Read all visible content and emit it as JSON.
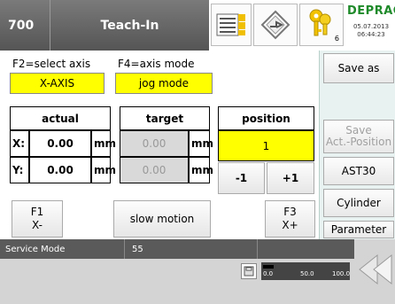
{
  "header": {
    "id": "700",
    "title": "Teach-In",
    "key_count": "6",
    "brand": "DEPRAG",
    "date": "05.07.2013",
    "time": "06:44:23"
  },
  "axis_select": {
    "label": "F2=select axis",
    "value": "X-AXIS"
  },
  "axis_mode": {
    "label": "F4=axis mode",
    "value": "jog mode"
  },
  "table": {
    "actual_header": "actual",
    "target_header": "target",
    "position_header": "position",
    "rows": [
      {
        "axis": "X:",
        "actual": "0.00",
        "actual_unit": "mm",
        "target": "0.00",
        "target_unit": "mm"
      },
      {
        "axis": "Y:",
        "actual": "0.00",
        "actual_unit": "mm",
        "target": "0.00",
        "target_unit": "mm"
      }
    ],
    "position_value": "1",
    "minus_label": "-1",
    "plus_label": "+1"
  },
  "buttons": {
    "f1_key": "F1",
    "f1_label": "X-",
    "slow_motion": "slow motion",
    "f3_key": "F3",
    "f3_label": "X+"
  },
  "sidebar": {
    "save_as": "Save as",
    "save_act_line1": "Save",
    "save_act_line2": "Act.-Position",
    "ast30": "AST30",
    "cylinder": "Cylinder",
    "parameter": "Parameter"
  },
  "status": {
    "mode": "Service Mode",
    "number": "55",
    "scale_labels": [
      "0.0",
      "50.0",
      "100.0"
    ],
    "progress": 0.12
  }
}
